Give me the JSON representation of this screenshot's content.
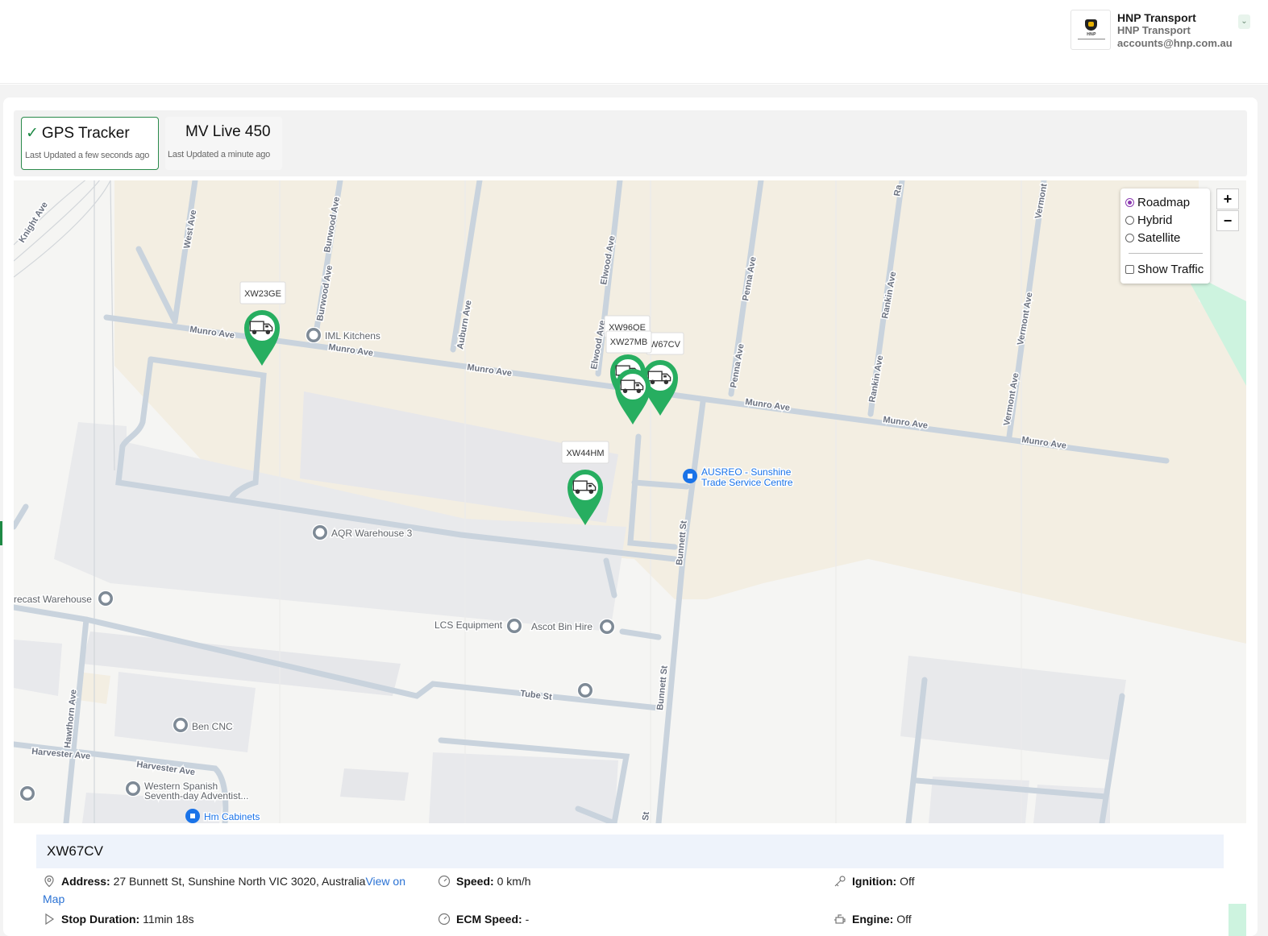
{
  "account": {
    "logo_text": "HNP",
    "name": "HNP Transport",
    "company": "HNP Transport",
    "email": "accounts@hnp.com.au"
  },
  "tabs": [
    {
      "label": "GPS Tracker",
      "check": "✓",
      "updated": "Last Updated a few seconds ago",
      "active": true
    },
    {
      "label": "MV Live 450",
      "updated": "Last Updated a minute ago",
      "active": false
    }
  ],
  "map_type": {
    "options": [
      "Roadmap",
      "Hybrid",
      "Satellite"
    ],
    "selected": "Roadmap",
    "traffic_label": "Show Traffic",
    "zoom_in": "+",
    "zoom_out": "−"
  },
  "vehicles": {
    "v1": "XW23GE",
    "v2": "XW96QE",
    "v3": "XW27MB",
    "v4": "W67CV",
    "v5": "XW44HM"
  },
  "map_labels": {
    "knight": "Knight Ave",
    "west": "West Ave",
    "burwood_n": "Burwood Ave",
    "burwood_s": "Burwood Ave",
    "auburn": "Auburn Ave",
    "elwood_n": "Elwood Ave",
    "elwood_s": "Elwood Ave",
    "penna_n": "Penna Ave",
    "penna_s": "Penna Ave",
    "rankin_n": "Rankin Ave",
    "rankin_s": "Rankin Ave",
    "vermont_n": "Vermont",
    "vermont_m": "Vermont Ave",
    "vermont_s": "Vermont Ave",
    "ra": "Ra",
    "munro_1": "Munro Ave",
    "munro_2": "Munro Ave",
    "munro_3": "Munro Ave",
    "munro_4": "Munro Ave",
    "munro_5": "Munro Ave",
    "munro_6": "Munro Ave",
    "bunnett_1": "Bunnett St",
    "bunnett_2": "Bunnett St",
    "bunnett_3": "St",
    "tube": "Tube St",
    "hawthorn": "Hawthorn Ave",
    "harvester_1": "Harvester Ave",
    "harvester_2": "Harvester Ave",
    "iml": "IML Kitchens",
    "ausreo_1": "AUSREO - Sunshine",
    "ausreo_2": "Trade Service Centre",
    "aqr": "AQR Warehouse 3",
    "precast": "recast Warehouse",
    "lcs": "LCS Equipment",
    "ascot": "Ascot Bin Hire",
    "bencnc": "Ben CNC",
    "church_1": "Western Spanish",
    "church_2": "Seventh-day Adventist...",
    "hm": "Hm Cabinets"
  },
  "details": {
    "vehicle": "XW67CV",
    "address_label": "Address:",
    "address": "27 Bunnett St, Sunshine North VIC 3020, Australia",
    "view_on": "View on",
    "map_link": "Map",
    "speed_label": "Speed:",
    "speed": "0 km/h",
    "ignition_label": "Ignition:",
    "ignition": "Off",
    "stop_label": "Stop Duration:",
    "stop": "11min 18s",
    "ecm_label": "ECM Speed:",
    "ecm": "-",
    "engine_label": "Engine:",
    "engine": "Off"
  },
  "colors": {
    "accent_green": "#1e8a45",
    "marker_green": "#27ae60",
    "link_blue": "#2a72d4",
    "road": "#c7d2dd",
    "land": "#f3eee2"
  }
}
